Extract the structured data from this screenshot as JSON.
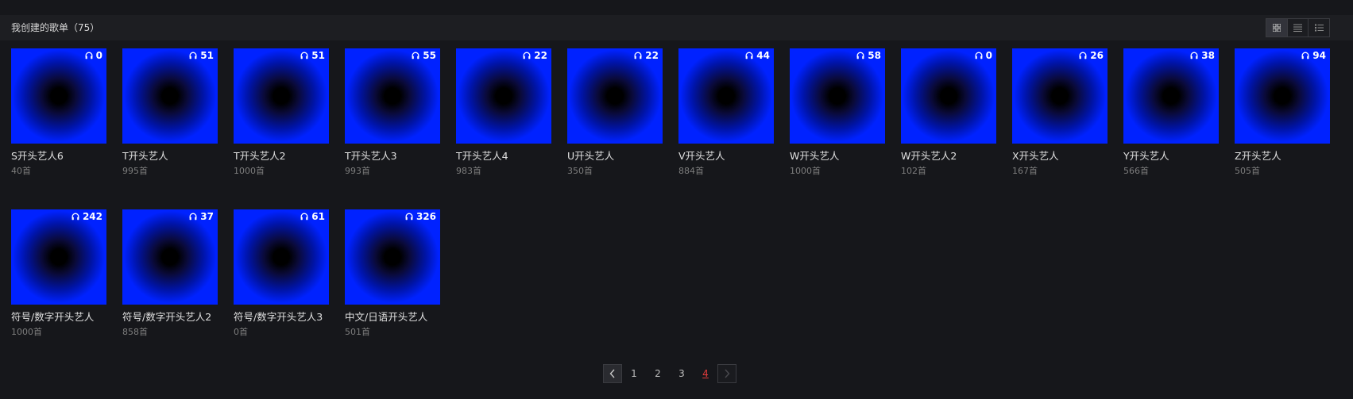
{
  "header": {
    "title": "我创建的歌单（75）",
    "view_modes": [
      {
        "icon": "grid-view-icon",
        "active": true
      },
      {
        "icon": "list-view-icon",
        "active": false
      },
      {
        "icon": "detail-list-view-icon",
        "active": false
      }
    ]
  },
  "playlists": [
    {
      "title": "S开头艺人6",
      "count": "40首",
      "plays": "0"
    },
    {
      "title": "T开头艺人",
      "count": "995首",
      "plays": "51"
    },
    {
      "title": "T开头艺人2",
      "count": "1000首",
      "plays": "51"
    },
    {
      "title": "T开头艺人3",
      "count": "993首",
      "plays": "55"
    },
    {
      "title": "T开头艺人4",
      "count": "983首",
      "plays": "22"
    },
    {
      "title": "U开头艺人",
      "count": "350首",
      "plays": "22"
    },
    {
      "title": "V开头艺人",
      "count": "884首",
      "plays": "44"
    },
    {
      "title": "W开头艺人",
      "count": "1000首",
      "plays": "58"
    },
    {
      "title": "W开头艺人2",
      "count": "102首",
      "plays": "0"
    },
    {
      "title": "X开头艺人",
      "count": "167首",
      "plays": "26"
    },
    {
      "title": "Y开头艺人",
      "count": "566首",
      "plays": "38"
    },
    {
      "title": "Z开头艺人",
      "count": "505首",
      "plays": "94"
    },
    {
      "title": "符号/数字开头艺人",
      "count": "1000首",
      "plays": "242"
    },
    {
      "title": "符号/数字开头艺人2",
      "count": "858首",
      "plays": "37"
    },
    {
      "title": "符号/数字开头艺人3",
      "count": "0首",
      "plays": "61"
    },
    {
      "title": "中文/日语开头艺人",
      "count": "501首",
      "plays": "326"
    }
  ],
  "pagination": {
    "pages": [
      "1",
      "2",
      "3",
      "4"
    ],
    "current": "4"
  },
  "colors": {
    "accent_current_page": "#e03b3b",
    "cover_blue": "#0022ff",
    "background": "#16171b"
  }
}
